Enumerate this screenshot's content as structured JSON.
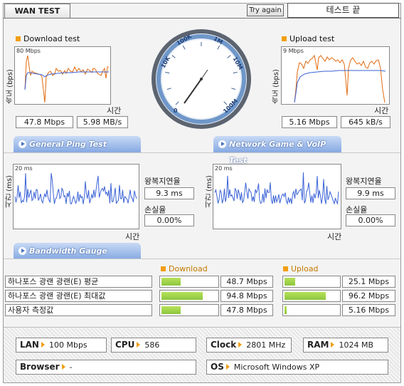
{
  "window": {
    "tab_title": "WAN TEST",
    "try_again_label": "Try again",
    "status_text": "테스트 끝"
  },
  "download": {
    "title": "Download test",
    "scale": "80 Mbps",
    "axis_y": "속도 (bps)",
    "axis_x": "시간",
    "mbps": "47.8 Mbps",
    "mbytes": "5.98 MB/s"
  },
  "upload": {
    "title": "Upload test",
    "scale": "9 Mbps",
    "axis_y": "속도 (bps)",
    "axis_x": "시간",
    "mbps": "5.16 Mbps",
    "kbytes": "645 kB/s"
  },
  "gauge": {
    "ticks": [
      "0",
      "10K",
      "100K",
      "1M",
      "10M",
      "100M"
    ],
    "needle_value": "47.8 Mbps"
  },
  "sections": {
    "ping": "General Ping Test",
    "game": "Network Game & VoIP Test",
    "bandwidth": "Bandwidth Gauge"
  },
  "ping": {
    "scale": "20 ms",
    "axis_y": "시간 (ms)",
    "axis_x": "시간",
    "latency_label": "왕복지연율",
    "latency_value": "9.3 ms",
    "loss_label": "손실율",
    "loss_value": "0.00%"
  },
  "game": {
    "scale": "20 ms",
    "axis_y": "시간 (ms)",
    "axis_x": "시간",
    "latency_label": "왕복지연율",
    "latency_value": "9.9 ms",
    "loss_label": "손실율",
    "loss_value": "0.00%"
  },
  "bandwidth": {
    "download_header": "Download",
    "upload_header": "Upload",
    "rows": [
      {
        "label": "하나포스 광랜 광랜(E) 평균",
        "download": "48.7 Mbps",
        "download_fill": 0.34,
        "upload": "25.1 Mbps",
        "upload_fill": 0.2
      },
      {
        "label": "하나포스 광랜 광랜(E) 최대값",
        "download": "94.8 Mbps",
        "download_fill": 0.74,
        "upload": "96.2 Mbps",
        "upload_fill": 0.76
      },
      {
        "label": "사용자 측정값",
        "download": "47.8 Mbps",
        "download_fill": 0.35,
        "upload": "5.16 Mbps",
        "upload_fill": 0.04
      }
    ]
  },
  "system": {
    "lan_label": "LAN",
    "lan_value": "100 Mbps",
    "cpu_label": "CPU",
    "cpu_value": "586",
    "clock_label": "Clock",
    "clock_value": "2801 MHz",
    "ram_label": "RAM",
    "ram_value": "1024 MB",
    "browser_label": "Browser",
    "browser_value": "-",
    "os_label": "OS",
    "os_value": "Microsoft Windows XP"
  },
  "colors": {
    "accent": "#f29e12",
    "line_orange": "#e26a10",
    "line_blue": "#3a62d6",
    "bar_green": "#8cc63f",
    "section_blue": "#86a9e2"
  }
}
